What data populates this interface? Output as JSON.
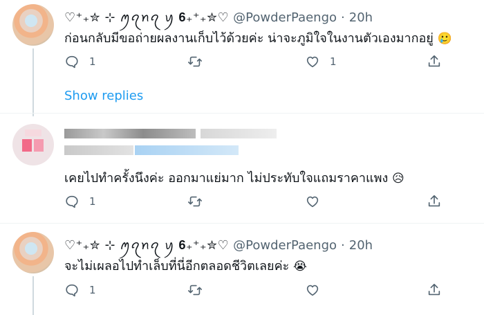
{
  "tweets": [
    {
      "display_name": "♡︎⁺₊✮ ⊹ ꪑꪖꪀꪖ ꪗ 𝟔₊⁺₊✮♡",
      "handle": "@PowderPaengo",
      "dot": "·",
      "time": "20h",
      "text": "ก่อนกลับมีขอถ่ายผลงานเก็บไว้ด้วยค่ะ น่าจะภูมิใจในงานตัวเองมากอยู่",
      "emoji": "🥲",
      "reply_count": "1",
      "like_count": "1"
    },
    {
      "text": "เคยไปทำครั้งนึงค่ะ ออกมาแย่มาก ไม่ประทับใจแถมราคาแพง",
      "emoji": "😥",
      "reply_count": "1",
      "like_count": ""
    },
    {
      "display_name": "♡︎⁺₊✮ ⊹ ꪑꪖꪀꪖ ꪗ 𝟔₊⁺₊✮♡",
      "handle": "@PowderPaengo",
      "dot": "·",
      "time": "20h",
      "text": "จะไม่เผลอไปทำเล็บที่นี่อีกตลอดชีวิตเลยค่ะ",
      "emoji": "😭",
      "reply_count": "1",
      "like_count": ""
    }
  ],
  "show_replies_label": "Show replies",
  "icons": [
    "reply-icon",
    "retweet-icon",
    "like-icon",
    "share-icon"
  ],
  "colors": {
    "link": "#1d9bf0",
    "muted": "#536471",
    "text": "#0f1419"
  }
}
